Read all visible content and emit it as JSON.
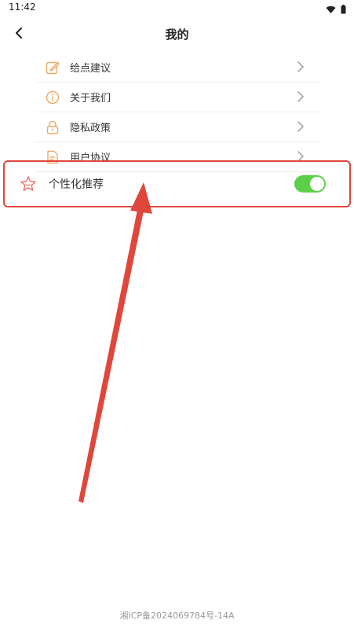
{
  "status_bar": {
    "time": "11:42",
    "icons": [
      "wifi-icon",
      "battery-icon"
    ]
  },
  "header": {
    "title": "我的",
    "back_icon": "chevron-left-icon"
  },
  "menu": {
    "items": [
      {
        "label": "给点建议",
        "icon": "edit-icon"
      },
      {
        "label": "关于我们",
        "icon": "info-icon"
      },
      {
        "label": "隐私政策",
        "icon": "lock-icon"
      },
      {
        "label": "用户协议",
        "icon": "document-icon"
      }
    ],
    "accent_color": "#f0a868"
  },
  "personalization": {
    "label": "个性化推荐",
    "icon": "star-icon",
    "toggle_on": true,
    "toggle_color": "#5ccf49",
    "highlight_color": "#e0473c"
  },
  "footer": {
    "icp": "湘ICP备2024069784号-14A"
  }
}
